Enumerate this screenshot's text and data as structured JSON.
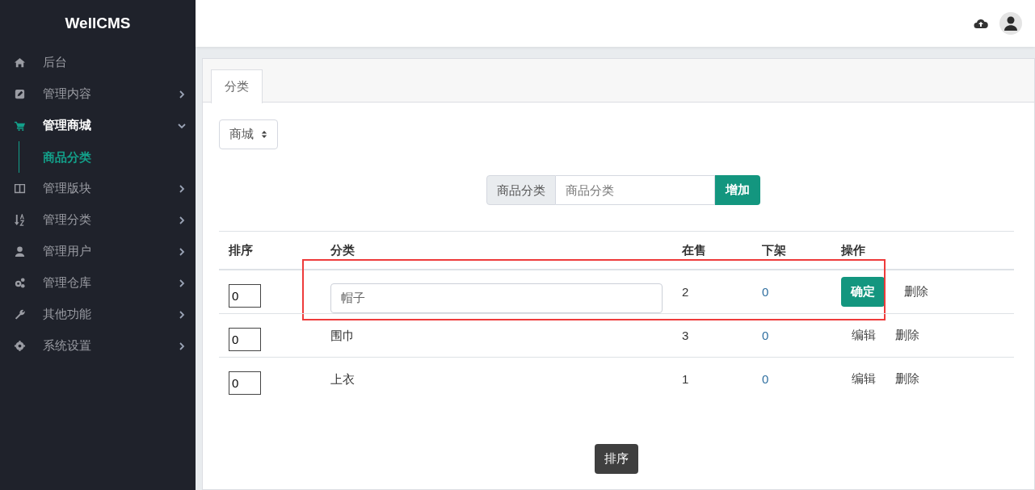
{
  "sidebar": {
    "brand": "WellCMS",
    "items": [
      {
        "label": "后台",
        "selected": false,
        "has_arrow": false
      },
      {
        "label": "管理内容",
        "selected": false,
        "expanded": false,
        "has_arrow": true
      },
      {
        "label": "管理商城",
        "selected": true,
        "expanded": true,
        "has_arrow": true,
        "children": [
          {
            "label": "商品分类",
            "selected": true
          }
        ]
      },
      {
        "label": "管理版块",
        "selected": false,
        "expanded": false,
        "has_arrow": true
      },
      {
        "label": "管理分类",
        "selected": false,
        "expanded": false,
        "has_arrow": true
      },
      {
        "label": "管理用户",
        "selected": false,
        "expanded": false,
        "has_arrow": true
      },
      {
        "label": "管理仓库",
        "selected": false,
        "expanded": false,
        "has_arrow": true
      },
      {
        "label": "其他功能",
        "selected": false,
        "expanded": false,
        "has_arrow": true
      },
      {
        "label": "系统设置",
        "selected": false,
        "expanded": false,
        "has_arrow": true
      }
    ]
  },
  "tabs": [
    {
      "label": "分类",
      "selected": true
    }
  ],
  "site_select": {
    "value": "商城"
  },
  "add_form": {
    "label": "商品分类",
    "placeholder": "商品分类",
    "button": "增加"
  },
  "table": {
    "columns": [
      "排序",
      "分类",
      "在售",
      "下架",
      "操作"
    ],
    "rows": [
      {
        "kind": "editing",
        "highlighted": true,
        "order": "0",
        "name": "帽子",
        "on_sale": "2",
        "off_shelf": "0",
        "action": "确定",
        "delete": "删除"
      },
      {
        "kind": "view",
        "highlighted": false,
        "order": "0",
        "name": "围巾",
        "on_sale": "3",
        "off_shelf": "0",
        "action": "编辑",
        "delete": "删除"
      },
      {
        "kind": "view",
        "highlighted": false,
        "order": "0",
        "name": "上衣",
        "on_sale": "1",
        "off_shelf": "0",
        "action": "编辑",
        "delete": "删除"
      }
    ]
  },
  "sort_button": "排序"
}
